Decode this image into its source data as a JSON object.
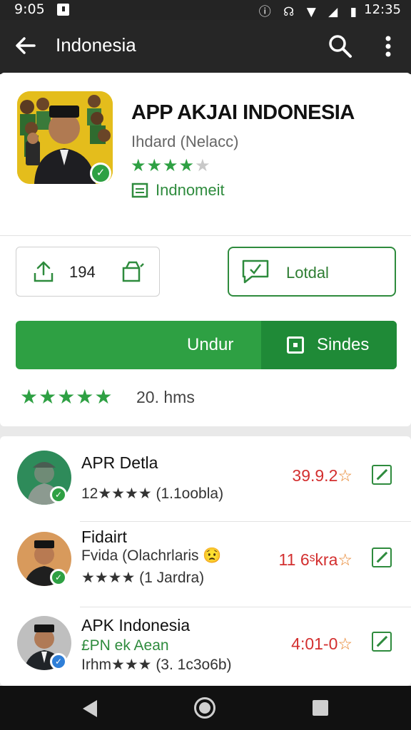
{
  "status_bar": {
    "time": "9:05",
    "icons": "ⓘ ☊ ▼ ◢ ▮",
    "right_time": "12:35"
  },
  "app_bar": {
    "title": "Indonesia"
  },
  "app": {
    "title": "APP AKJAI INDONESIA",
    "developer": "Ihdard (Nelacc)",
    "rating_stars": 4,
    "category": "Indnomeit"
  },
  "actions": {
    "share_count": "194",
    "secondary_button": "Lotdal"
  },
  "install": {
    "main_label": "Undur",
    "side_label": "Sindes"
  },
  "summary": {
    "stars": 5,
    "text": "20. hms"
  },
  "list": [
    {
      "name": "APR Detla",
      "line1": "12★★★★ (1.1oobla)",
      "line2": "",
      "price": "39.9.2",
      "badge": "green"
    },
    {
      "name": "Fidairt",
      "line1": "Fvida (Olachrlaris 😟",
      "line2": "★★★★ (1 Jardra)",
      "price": "11 6ˢkra",
      "badge": "green"
    },
    {
      "name": "APK Indonesia",
      "line1": "£PN ek Aean",
      "line2": "Irhm★★★ (3. 1c3o6b)",
      "price": "4:01-0",
      "badge": "blue"
    }
  ],
  "colors": {
    "accent": "#2ea043",
    "accent_dark": "#1f8a37",
    "price": "#d32f2f"
  }
}
